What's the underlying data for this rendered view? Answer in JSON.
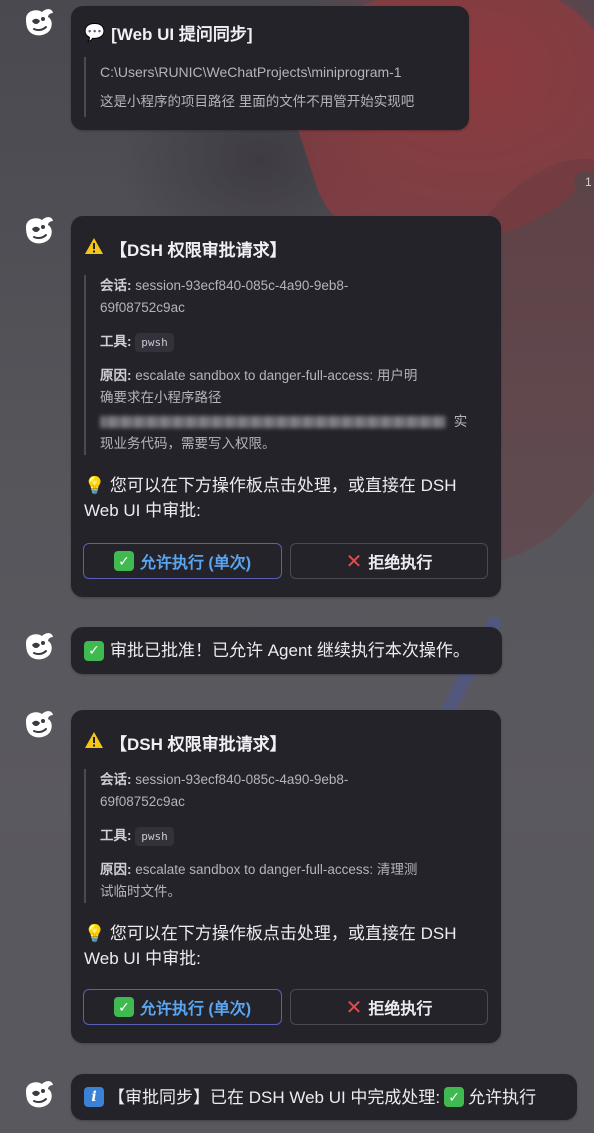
{
  "unread_badge": "1",
  "messages": [
    {
      "title": "[Web UI 提问同步]",
      "icon": "speech-bubble-icon",
      "lines": [
        "C:\\Users\\RUNIC\\WeChatProjects\\miniprogram-1",
        "这是小程序的项目路径 里面的文件不用管开始实现吧"
      ]
    },
    {
      "title": "【DSH 权限审批请求】",
      "icon": "warning-icon",
      "session_label": "会话:",
      "session_value_1": "session-93ecf840-085c-4a90-9eb8-",
      "session_value_2": "69f08752c9ac",
      "tool_label": "工具:",
      "tool_value": "pwsh",
      "reason_label": "原因:",
      "reason_line_1": "escalate sandbox to danger-full-access: 用户明",
      "reason_line_2": "确要求在小程序路径",
      "reason_line_3_tail": "实",
      "reason_line_4": "现业务代码，需要写入权限。",
      "hint": "💡 您可以在下方操作板点击处理，或直接在 DSH Web UI 中审批:",
      "allow_label": "允许执行 (单次)",
      "deny_label": "拒绝执行"
    },
    {
      "text": "审批已批准！已允许 Agent 继续执行本次操作。",
      "icon": "check-icon"
    },
    {
      "title": "【DSH 权限审批请求】",
      "icon": "warning-icon",
      "session_label": "会话:",
      "session_value_1": "session-93ecf840-085c-4a90-9eb8-",
      "session_value_2": "69f08752c9ac",
      "tool_label": "工具:",
      "tool_value": "pwsh",
      "reason_label": "原因:",
      "reason_line_1": "escalate sandbox to danger-full-access: 清理测",
      "reason_line_2": "试临时文件。",
      "hint": "💡 您可以在下方操作板点击处理，或直接在 DSH Web UI 中审批:",
      "allow_label": "允许执行 (单次)",
      "deny_label": "拒绝执行"
    },
    {
      "text_before": "【审批同步】已在 DSH Web UI 中完成处理:",
      "text_after": "允许执行",
      "icon": "info-icon"
    }
  ],
  "colors": {
    "bubble": "#242329",
    "allow_text": "#5aa4f0",
    "allow_border": "#5a5fb8",
    "check_green": "#3fb950",
    "warning_yellow": "#f5c518",
    "deny_red": "#e5484d"
  }
}
